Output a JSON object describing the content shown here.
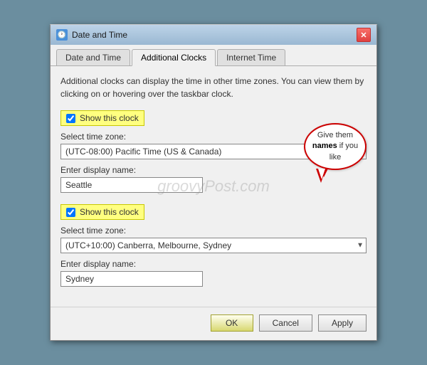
{
  "window": {
    "title": "Date and Time",
    "close_label": "✕"
  },
  "tabs": [
    {
      "id": "date-and-time",
      "label": "Date and Time",
      "active": false
    },
    {
      "id": "additional-clocks",
      "label": "Additional Clocks",
      "active": true
    },
    {
      "id": "internet-time",
      "label": "Internet Time",
      "active": false
    }
  ],
  "description": "Additional clocks can display the time in other time zones. You can view them by clicking on or hovering over the taskbar clock.",
  "clock1": {
    "show_label": "Show this clock",
    "checked": true,
    "timezone_label": "Select time zone:",
    "timezone_value": "(UTC-08:00) Pacific Time (US & Canada)",
    "name_label": "Enter display name:",
    "name_value": "Seattle"
  },
  "clock2": {
    "show_label": "Show this clock",
    "checked": true,
    "timezone_label": "Select time zone:",
    "timezone_value": "(UTC+10:00) Canberra, Melbourne, Sydney",
    "name_label": "Enter display name:",
    "name_value": "Sydney"
  },
  "callout": {
    "text_before": "Give them ",
    "bold_text": "names",
    "text_after": " if you like"
  },
  "watermark": "groovyPost.com",
  "footer": {
    "ok_label": "OK",
    "cancel_label": "Cancel",
    "apply_label": "Apply"
  }
}
